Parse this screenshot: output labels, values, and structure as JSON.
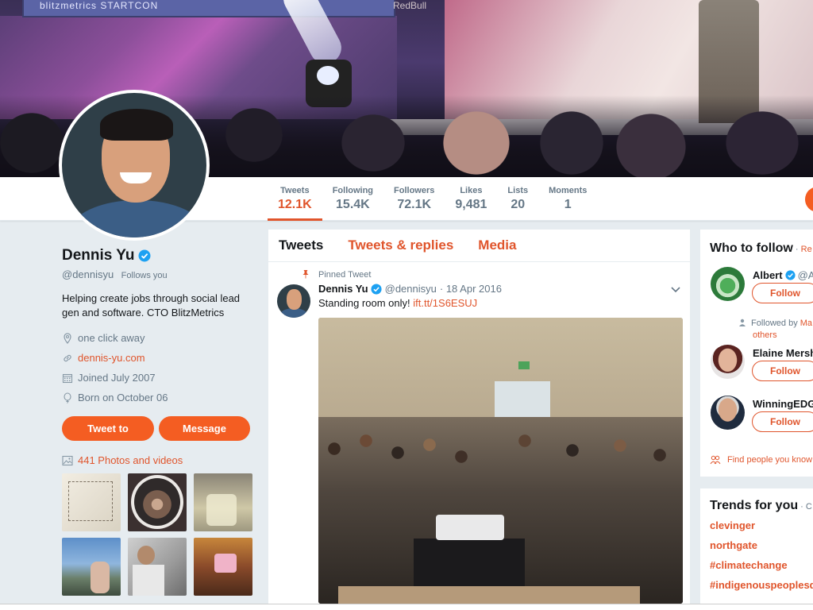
{
  "banner": {
    "screen_text": "blitzmetrics   STARTCON",
    "brand_text": "RedBull"
  },
  "stats": [
    {
      "label": "Tweets",
      "value": "12.1K"
    },
    {
      "label": "Following",
      "value": "15.4K"
    },
    {
      "label": "Followers",
      "value": "72.1K"
    },
    {
      "label": "Likes",
      "value": "9,481"
    },
    {
      "label": "Lists",
      "value": "20"
    },
    {
      "label": "Moments",
      "value": "1"
    }
  ],
  "profile": {
    "name": "Dennis Yu",
    "handle": "@dennisyu",
    "follows_you": "Follows you",
    "bio": "Helping create jobs through social lead gen and software. CTO BlitzMetrics",
    "location": "one click away",
    "website": "dennis-yu.com",
    "joined": "Joined July 2007",
    "born": "Born on October 06",
    "tweet_to": "Tweet to",
    "message": "Message",
    "photos_link": "441 Photos and videos"
  },
  "timeline": {
    "tabs": [
      "Tweets",
      "Tweets & replies",
      "Media"
    ],
    "pinned_label": "Pinned Tweet",
    "tweet": {
      "name": "Dennis Yu",
      "handle": "@dennisyu",
      "date": "· 18 Apr 2016",
      "text": "Standing room only! ",
      "link": "ift.tt/1S6ESUJ"
    }
  },
  "who_to_follow": {
    "title": "Who to follow",
    "sep": " · ",
    "refresh": "Re",
    "suggestions": [
      {
        "name": "Albert",
        "handle": "@Al",
        "button": "Follow"
      },
      {
        "name": "Elaine Mersh",
        "handle": "",
        "button": "Follow"
      },
      {
        "name": "WinningEDG",
        "handle": "",
        "button": "Follow"
      }
    ],
    "followed_by_prefix": "Followed by ",
    "followed_by_link": "Ma",
    "followed_by_others": "others",
    "find_people": "Find people you know"
  },
  "trends": {
    "title": "Trends for you",
    "sep": " · C",
    "items": [
      "clevinger",
      "northgate",
      "#climatechange",
      "#indigenouspeoplesd"
    ]
  },
  "colors": {
    "accent": "#e0552c",
    "button": "#f45d22",
    "verified": "#1da1f2"
  }
}
